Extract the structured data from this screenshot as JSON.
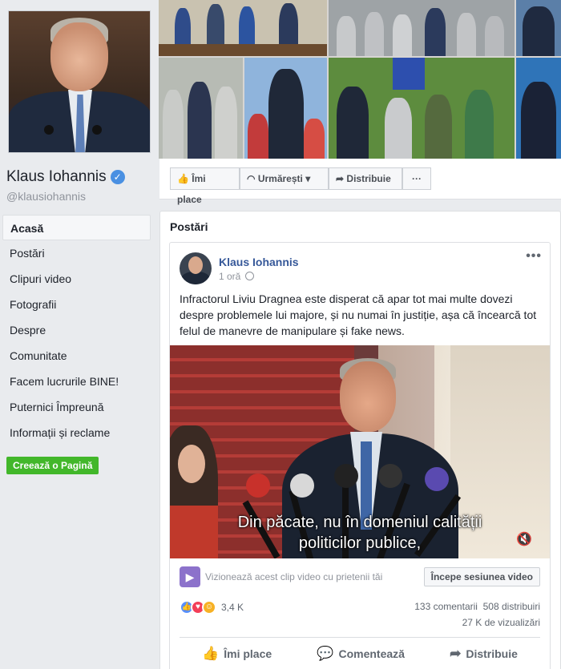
{
  "page": {
    "name": "Klaus Iohannis",
    "handle": "@klausiohannis",
    "verified_glyph": "✓"
  },
  "nav": {
    "items": [
      {
        "label": "Acasă",
        "active": true
      },
      {
        "label": "Postări"
      },
      {
        "label": "Clipuri video"
      },
      {
        "label": "Fotografii"
      },
      {
        "label": "Despre"
      },
      {
        "label": "Comunitate"
      },
      {
        "label": "Facem lucrurile BINE!"
      },
      {
        "label": "Puternici Împreună"
      },
      {
        "label": "Informații și reclame"
      }
    ],
    "create_page": "Creează o Pagină"
  },
  "actions": {
    "like": "Îmi place",
    "follow": "Urmărești",
    "share": "Distribuie",
    "more": "···"
  },
  "posts": {
    "title": "Postări"
  },
  "post": {
    "author": "Klaus Iohannis",
    "time": "1 oră",
    "more": "•••",
    "text": "Infractorul Liviu Dragnea este disperat că apar tot mai multe dovezi despre problemele lui majore, și nu numai în justiție, așa că încearcă tot felul de manevre de manipulare și fake news.",
    "video": {
      "subtitle_line1": "Din păcate, nu în domeniul calității",
      "subtitle_line2": "politicilor publice,"
    },
    "watch_party": {
      "text": "Vizionează acest clip video cu prietenii tăi",
      "button": "Începe sesiunea video"
    },
    "reactions": {
      "count": "3,4 K",
      "types": [
        "like-icon",
        "love-icon",
        "haha-icon"
      ]
    },
    "stats": {
      "comments": "133 comentarii",
      "shares": "508 distribuiri",
      "views": "27 K de vizualizări"
    },
    "buttons": {
      "like": "Îmi place",
      "comment": "Comentează",
      "share": "Distribuie"
    }
  },
  "colors": {
    "link_blue": "#365899",
    "verified_blue": "#4a90e2",
    "create_green": "#42b72a",
    "background": "#e9ebee"
  }
}
